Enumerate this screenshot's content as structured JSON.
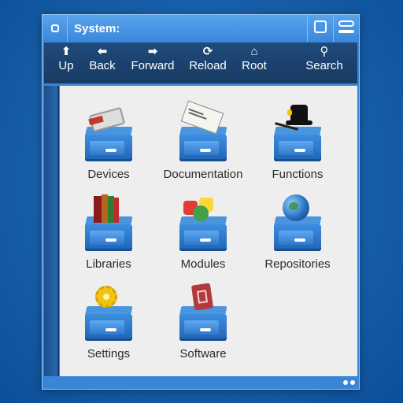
{
  "window": {
    "title": "System:",
    "close_icon": "close-icon",
    "depth_icon": "depth-icon",
    "zoom_icon": "zoom-icon"
  },
  "toolbar": {
    "items": [
      {
        "label": "Up",
        "icon": "up-arrow-icon",
        "glyph": "⬆"
      },
      {
        "label": "Back",
        "icon": "back-arrow-icon",
        "glyph": "⬅"
      },
      {
        "label": "Forward",
        "icon": "forward-arrow-icon",
        "glyph": "➡"
      },
      {
        "label": "Reload",
        "icon": "reload-icon",
        "glyph": "⟳"
      },
      {
        "label": "Root",
        "icon": "home-icon",
        "glyph": "⌂"
      },
      {
        "label": "Search",
        "icon": "search-icon",
        "glyph": "⚲"
      }
    ]
  },
  "content": {
    "items": [
      {
        "label": "Devices",
        "icon": "devices-drawer-icon"
      },
      {
        "label": "Documentation",
        "icon": "documentation-drawer-icon"
      },
      {
        "label": "Functions",
        "icon": "functions-drawer-icon"
      },
      {
        "label": "Libraries",
        "icon": "libraries-drawer-icon"
      },
      {
        "label": "Modules",
        "icon": "modules-drawer-icon"
      },
      {
        "label": "Repositories",
        "icon": "repositories-drawer-icon"
      },
      {
        "label": "Settings",
        "icon": "settings-drawer-icon"
      },
      {
        "label": "Software",
        "icon": "software-drawer-icon"
      }
    ]
  },
  "colors": {
    "desktop": "#1a63ad",
    "titlebar": "#3a87dc",
    "toolbar": "#1f4a7a",
    "content_bg": "#eeeeee",
    "drawer": "#2f78cc"
  }
}
